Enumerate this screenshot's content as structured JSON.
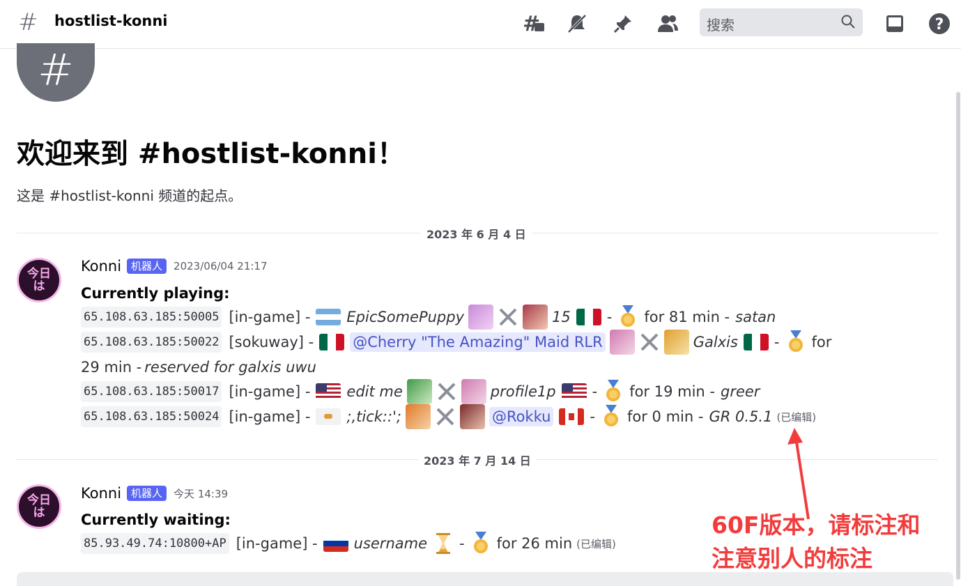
{
  "header": {
    "channel_name": "hostlist-konni",
    "search_placeholder": "搜索",
    "icons": [
      "threads-icon",
      "mute-bell-icon",
      "pin-icon",
      "members-icon",
      "search-icon",
      "inbox-icon",
      "help-icon"
    ]
  },
  "welcome": {
    "title": "欢迎来到 #hostlist-konni！",
    "subtitle": "这是 #hostlist-konni 频道的起点。"
  },
  "dividers": [
    "2023 年 6 月 4 日",
    "2023 年 7 月 14 日"
  ],
  "messages": [
    {
      "avatar_text": "今日は",
      "author": "Konni",
      "bot_tag": "机器人",
      "timestamp": "2023/06/04 21:17",
      "heading": "Currently playing:",
      "lines": [
        {
          "addr": "65.108.63.185:50005",
          "status": "[in-game] -",
          "name": "EpicSomePuppy",
          "num": "15",
          "sep": "-",
          "time": "for 81 min -",
          "note": "satan"
        },
        {
          "addr": "65.108.63.185:50022",
          "status": "[sokuway] -",
          "mention": "@Cherry \"The Amazing\" Maid RLR",
          "name": "Galxis",
          "sep": "-",
          "time": "for",
          "wrap": "29 min -",
          "note": "reserved for galxis uwu"
        },
        {
          "addr": "65.108.63.185:50017",
          "status": "[in-game] -",
          "name": "edit me",
          "name2": "profile1p",
          "sep": "-",
          "time": "for 19 min -",
          "note": "greer"
        },
        {
          "addr": "65.108.63.185:50024",
          "status": "[in-game] -",
          "name": ";,tick::';",
          "mention": "@Rokku",
          "sep": "-",
          "time": "for 0 min -",
          "note": "GR 0.5.1",
          "edited": "(已编辑)"
        }
      ]
    },
    {
      "avatar_text": "今日は",
      "author": "Konni",
      "bot_tag": "机器人",
      "timestamp": "今天 14:39",
      "heading": "Currently waiting:",
      "lines": [
        {
          "addr": "85.93.49.74:10800+AP",
          "status": "[in-game] -",
          "name": "username",
          "sep": "-",
          "time": "for 26 min",
          "edited": "(已编辑)"
        }
      ]
    }
  ],
  "annotation": {
    "line1": "60F版本，请标注和",
    "line2": "注意别人的标注",
    "color": "#f23c3c"
  },
  "colors": {
    "accent": "#5865f2",
    "mention_bg": "#e6e8fd",
    "annotation": "#f23c3c"
  }
}
